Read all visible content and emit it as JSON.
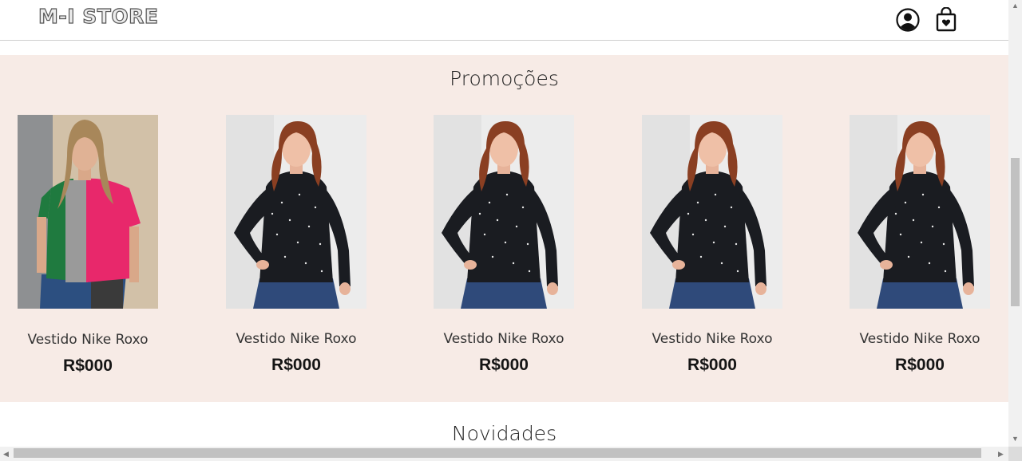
{
  "header": {
    "logo": "M-I STORE",
    "icons": {
      "account": "user-circle-icon",
      "cart": "shopping-bag-heart-icon"
    }
  },
  "promotions": {
    "title": "Promoções",
    "products": [
      {
        "name": "Vestido Nike Roxo",
        "price": "R$000",
        "image": "colorblock-tshirt-photo"
      },
      {
        "name": "Vestido Nike Roxo",
        "price": "R$000",
        "image": "black-sweater-photo"
      },
      {
        "name": "Vestido Nike Roxo",
        "price": "R$000",
        "image": "black-sweater-photo"
      },
      {
        "name": "Vestido Nike Roxo",
        "price": "R$000",
        "image": "black-sweater-photo"
      },
      {
        "name": "Vestido Nike Roxo",
        "price": "R$000",
        "image": "black-sweater-photo"
      }
    ]
  },
  "novidades": {
    "title": "Novidades"
  },
  "colors": {
    "promo_background": "#f7ebe6",
    "header_border": "#cfcfcf"
  }
}
